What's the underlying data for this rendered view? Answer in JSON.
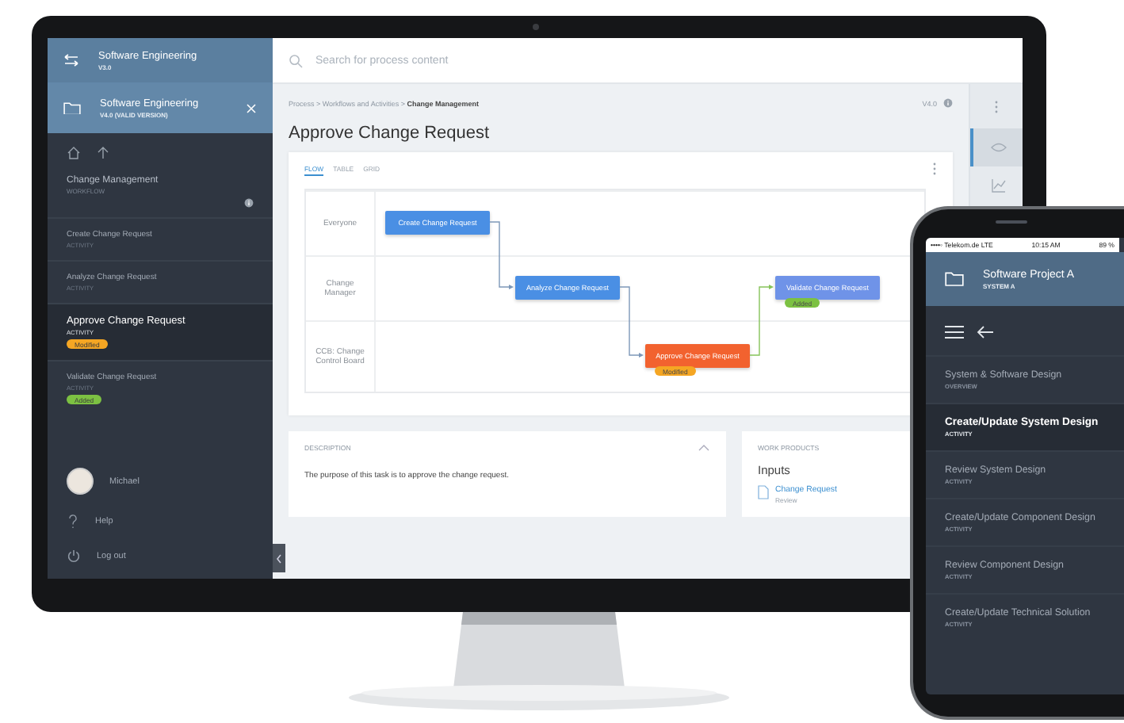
{
  "monitor": {
    "sidebar": {
      "switcher": {
        "title": "Software Engineering",
        "subtitle": "V3.0"
      },
      "project": {
        "title": "Software Engineering",
        "subtitle": "V4.0 (VALID VERSION)"
      },
      "workflow": {
        "title": "Change Management",
        "type": "WORKFLOW"
      },
      "activities": [
        {
          "name": "Create Change Request",
          "type": "ACTIVITY",
          "selected": false
        },
        {
          "name": "Analyze Change Request",
          "type": "ACTIVITY",
          "selected": false
        },
        {
          "name": "Approve Change Request",
          "type": "ACTIVITY",
          "selected": true,
          "badge": {
            "label": "Modified",
            "kind": "modified"
          }
        },
        {
          "name": "Validate Change Request",
          "type": "ACTIVITY",
          "selected": false,
          "badge": {
            "label": "Added",
            "kind": "added"
          }
        }
      ],
      "user": {
        "name": "Michael"
      },
      "menu": [
        {
          "label": "Help",
          "kind": "help"
        },
        {
          "label": "Log out",
          "kind": "logout"
        }
      ]
    },
    "search": {
      "placeholder": "Search for process content"
    },
    "breadcrumb": "Process > Workflows and Activities > **Change Management**",
    "version": "V4.0",
    "title": "Approve Change Request",
    "view_tabs": [
      {
        "label": "FLOW",
        "selected": true
      },
      {
        "label": "TABLE",
        "selected": false
      },
      {
        "label": "GRID",
        "selected": false
      }
    ],
    "diagram": {
      "lanes": [
        {
          "label": "Everyone",
          "steps": [
            {
              "kind": "task",
              "label": "Create Change Request",
              "color": "#4a8fe4"
            },
            {
              "kind": "gap"
            },
            {
              "kind": "gap"
            },
            {
              "kind": "gap"
            }
          ]
        },
        {
          "label": "Change Manager",
          "steps": [
            {
              "kind": "gap"
            },
            {
              "kind": "task",
              "label": "Analyze Change Request",
              "color": "#4a8fe4"
            },
            {
              "kind": "gap"
            },
            {
              "kind": "task",
              "label": "Validate Change Request",
              "color": "#6f93e8",
              "badge": {
                "label": "Added",
                "kind": "added"
              }
            }
          ]
        },
        {
          "label": "CCB: Change Control Board",
          "steps": [
            {
              "kind": "gap"
            },
            {
              "kind": "gap"
            },
            {
              "kind": "task",
              "label": "Approve Change Request",
              "color": "#f2622f",
              "badge": {
                "label": "Modified",
                "kind": "modified"
              }
            },
            {
              "kind": "gap"
            }
          ]
        }
      ]
    },
    "description": {
      "heading": "DESCRIPTION",
      "text": "The purpose of this task is to approve the change request."
    },
    "work_products": {
      "heading": "WORK PRODUCTS",
      "group": "Inputs",
      "items": [
        {
          "name": "Change Request",
          "state": "Review"
        }
      ]
    },
    "rail": [
      {
        "selected": true
      },
      {
        "selected": false
      }
    ]
  },
  "phone": {
    "status": {
      "carrier": "••••◦ Telekom.de LTE",
      "time": "10:15 AM",
      "battery": "89 %"
    },
    "project": {
      "title": "Software Project A",
      "subtitle": "SYSTEM A"
    },
    "items": [
      {
        "title": "System & Software Design",
        "type": "OVERVIEW",
        "selected": false
      },
      {
        "title": "Create/Update System Design",
        "type": "ACTIVITY",
        "selected": true
      },
      {
        "title": "Review System Design",
        "type": "ACTIVITY",
        "selected": false
      },
      {
        "title": "Create/Update Component Design",
        "type": "ACTIVITY",
        "selected": false
      },
      {
        "title": "Review Component Design",
        "type": "ACTIVITY",
        "selected": false
      },
      {
        "title": "Create/Update Technical Solution",
        "type": "ACTIVITY",
        "selected": false
      }
    ]
  }
}
